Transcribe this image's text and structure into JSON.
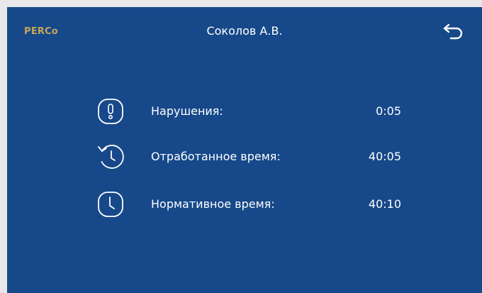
{
  "header": {
    "logo_text": "PERCo",
    "title": "Соколов А.В.",
    "back_icon": "back-arrow-icon"
  },
  "stats": [
    {
      "icon": "exclamation-icon",
      "label": "Нарушения:",
      "value": "0:05"
    },
    {
      "icon": "history-clock-icon",
      "label": "Отработанное время:",
      "value": "40:05"
    },
    {
      "icon": "clock-icon",
      "label": "Нормативное время:",
      "value": "40:10"
    }
  ],
  "colors": {
    "background": "#17498a",
    "logo": "#c7a55a",
    "text": "#ffffff",
    "frame": "#e8e8ea"
  }
}
